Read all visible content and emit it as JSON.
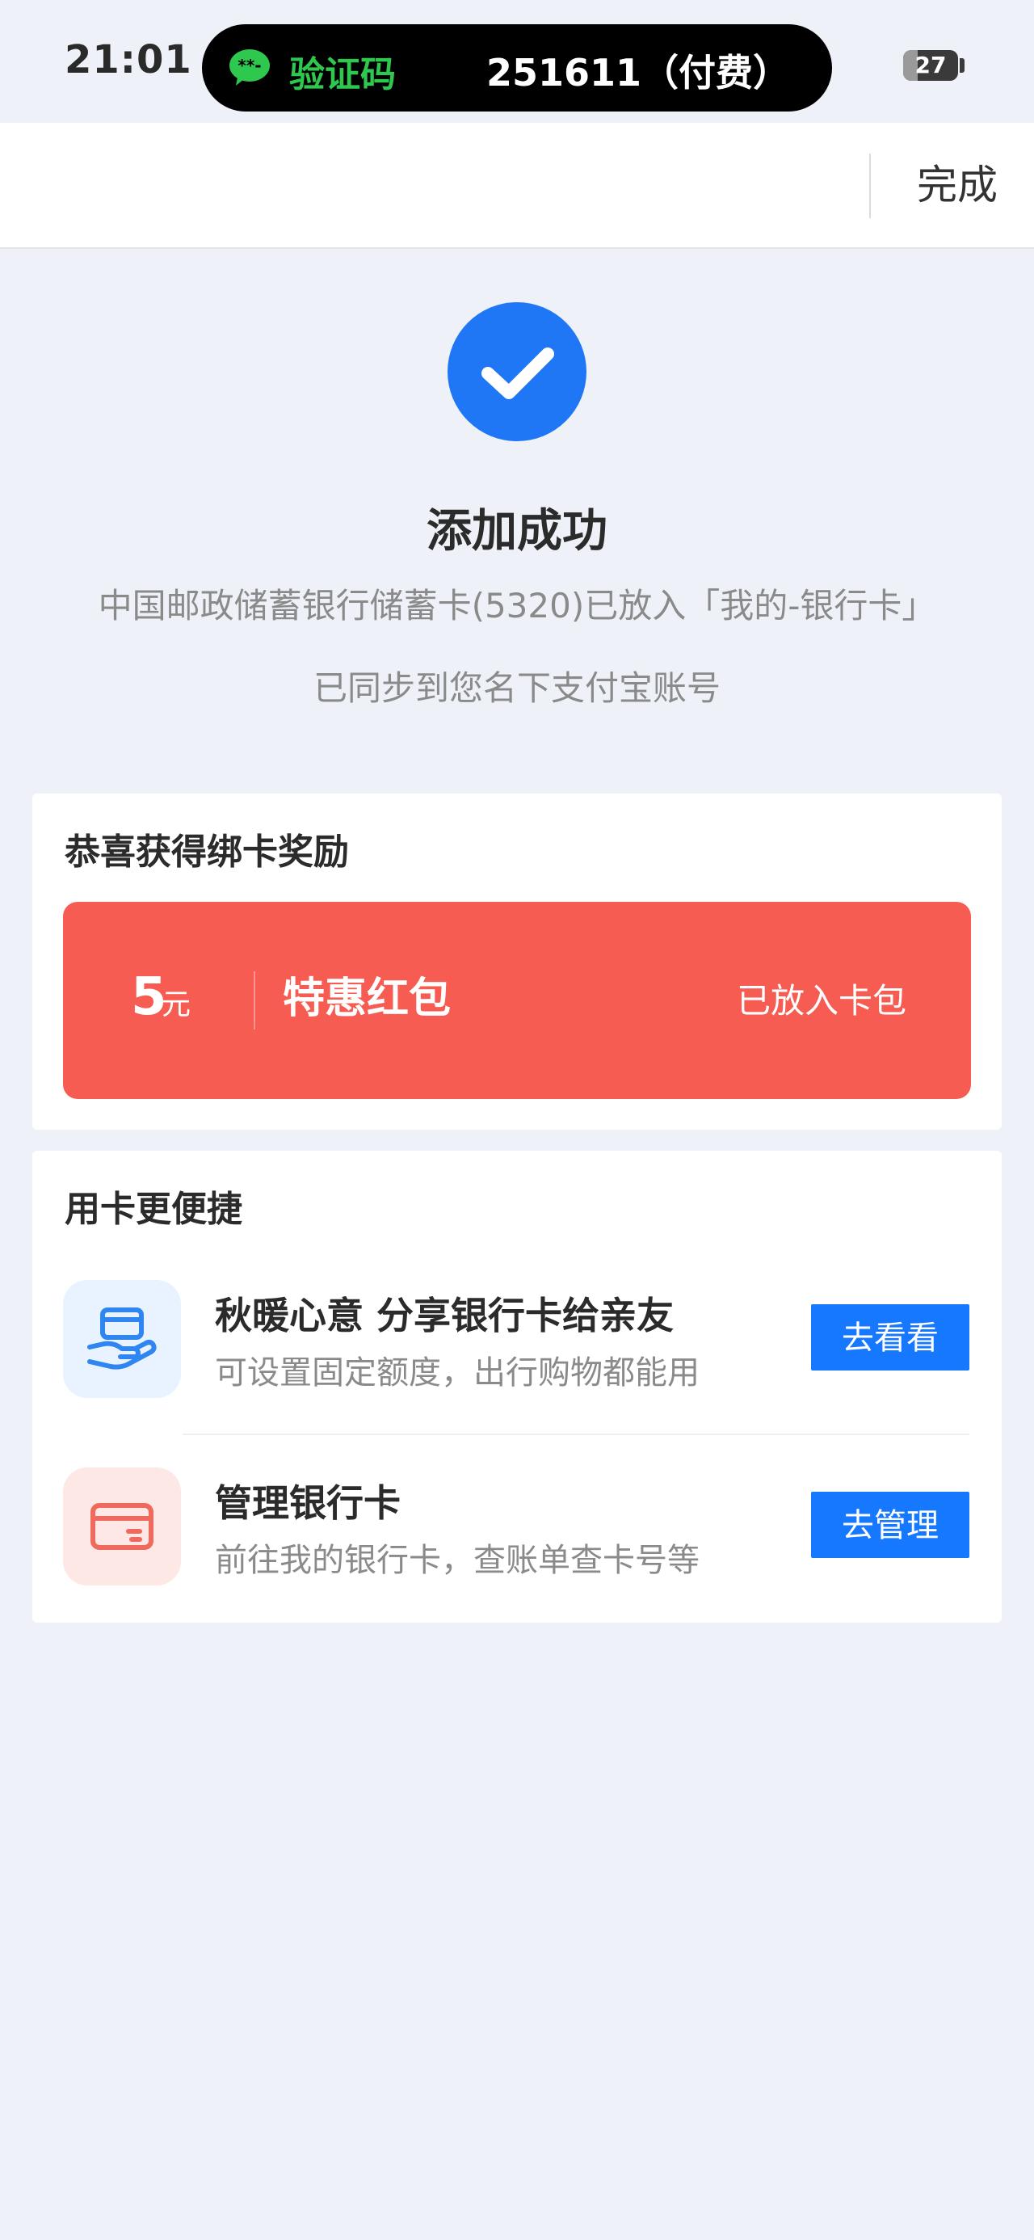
{
  "status_bar": {
    "time": "21:01",
    "notification": {
      "label": "验证码",
      "code": "251611（付费）"
    },
    "battery": {
      "level": 27,
      "text": "27"
    }
  },
  "nav": {
    "done_label": "完成"
  },
  "result": {
    "title": "添加成功",
    "description": "中国邮政储蓄银行储蓄卡(5320)已放入「我的-银行卡」",
    "sync_text": "已同步到您名下支付宝账号"
  },
  "reward": {
    "section_title": "恭喜获得绑卡奖励",
    "amount": "5",
    "unit": "元",
    "title": "特惠红包",
    "status": "已放入卡包"
  },
  "services": {
    "section_title": "用卡更便捷",
    "items": [
      {
        "title": "秋暖心意 分享银行卡给亲友",
        "subtitle": "可设置固定额度，出行购物都能用",
        "button": "去看看",
        "icon": "share-card-icon"
      },
      {
        "title": "管理银行卡",
        "subtitle": "前往我的银行卡，查账单查卡号等",
        "button": "去管理",
        "icon": "bank-card-icon"
      }
    ]
  },
  "colors": {
    "accent_blue": "#1677ff",
    "success_blue": "#1f77f5",
    "red_packet": "#f65c52",
    "wechat_green": "#2fc84f",
    "background": "#eef2f8"
  }
}
